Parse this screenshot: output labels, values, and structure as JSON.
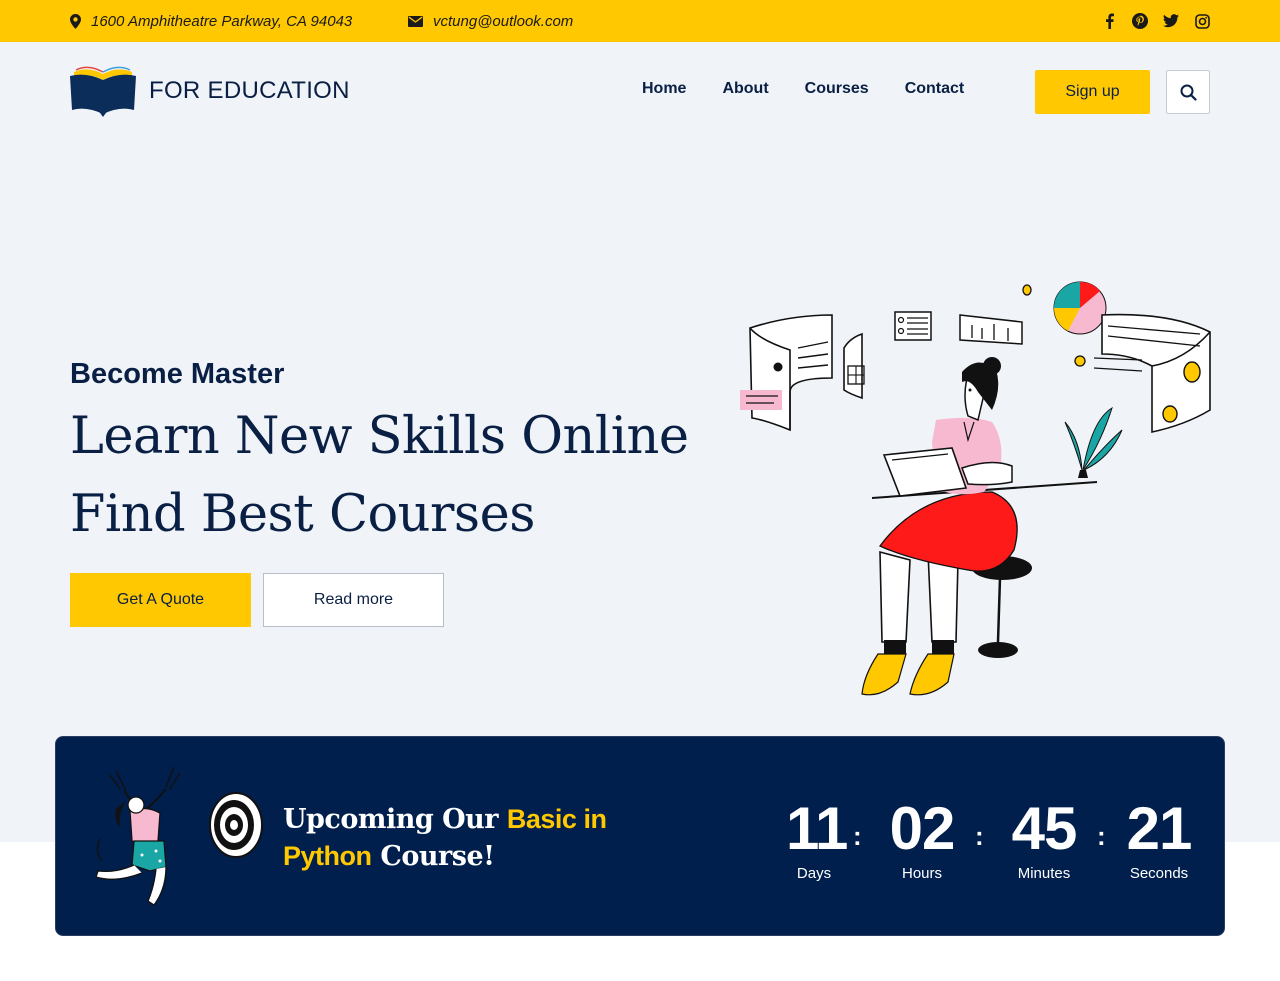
{
  "topbar": {
    "address": "1600 Amphitheatre Parkway, CA 94043",
    "email": "vctung@outlook.com",
    "socials": [
      "facebook-icon",
      "pinterest-icon",
      "twitter-icon",
      "instagram-icon"
    ]
  },
  "header": {
    "logo_text": "FOR EDUCATION",
    "nav": [
      "Home",
      "About",
      "Courses",
      "Contact"
    ],
    "signup_label": "Sign up"
  },
  "hero": {
    "subtitle": "Become Master",
    "title_line1": "Learn New Skills Online",
    "title_line2": "Find Best Courses",
    "quote_label": "Get A Quote",
    "readmore_label": "Read more"
  },
  "banner": {
    "title_part1": "Upcoming Our ",
    "title_highlight1": "Basic in",
    "title_highlight2": "Python",
    "title_part2": " Course!",
    "countdown": [
      {
        "value": "11",
        "label": "Days"
      },
      {
        "value": "02",
        "label": "Hours"
      },
      {
        "value": "45",
        "label": "Minutes"
      },
      {
        "value": "21",
        "label": "Seconds"
      }
    ]
  },
  "colors": {
    "accent": "#ffc800",
    "navy": "#0a1f44",
    "banner_bg": "#001f4d",
    "hero_bg": "#f0f3f8"
  }
}
